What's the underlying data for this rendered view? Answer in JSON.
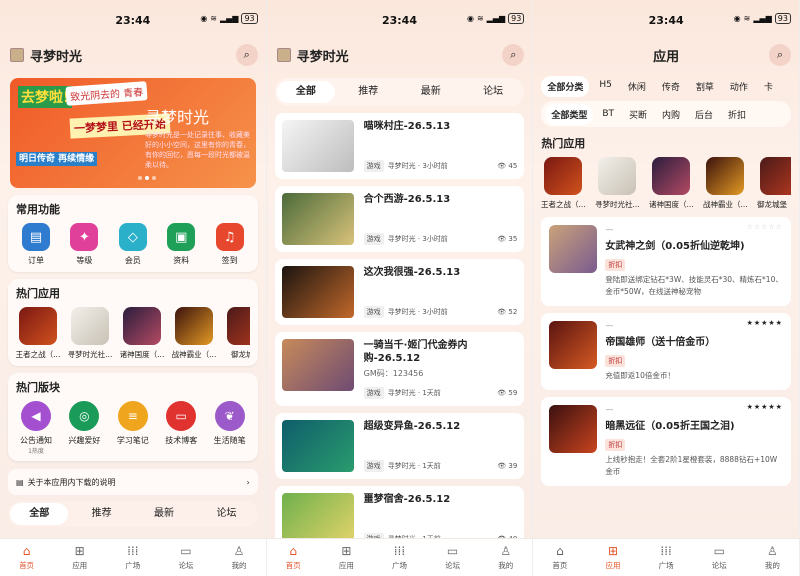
{
  "status": {
    "time": "23:44",
    "battery": "93"
  },
  "panel1": {
    "title": "寻梦时光",
    "banner": {
      "t1": "去梦啦!",
      "t2": "致光阴去的 青春",
      "t3": "一梦梦里 已经开始",
      "t4": "明日传奇 再续情缘",
      "title": "寻梦时光",
      "sub": "寻梦时光是一处记录往事、收藏美好的小小空间，这里有你的青春，有你的回忆，愿每一段时光都被温柔以待。"
    },
    "functions": {
      "title": "常用功能",
      "items": [
        {
          "label": "订单",
          "color": "#2e7bcf",
          "icon": "order-icon"
        },
        {
          "label": "等级",
          "color": "#e0409a",
          "icon": "level-icon"
        },
        {
          "label": "会员",
          "color": "#2bb0c9",
          "icon": "vip-icon"
        },
        {
          "label": "资料",
          "color": "#1fa058",
          "icon": "profile-icon"
        },
        {
          "label": "签到",
          "color": "#e6472d",
          "icon": "bell-icon"
        }
      ]
    },
    "hot_apps": {
      "title": "热门应用",
      "items": [
        {
          "name": "王者之战（..."
        },
        {
          "name": "寻梦时光社..."
        },
        {
          "name": "诸神国度（..."
        },
        {
          "name": "战神霸业（..."
        },
        {
          "name": "御龙城堡"
        }
      ]
    },
    "sections": {
      "title": "热门版块",
      "items": [
        {
          "label": "公告通知",
          "sub": "1热度",
          "color": "#a44fd0"
        },
        {
          "label": "兴趣爱好",
          "sub": "",
          "color": "#1b9b59"
        },
        {
          "label": "学习笔记",
          "sub": "",
          "color": "#f0a51f"
        },
        {
          "label": "技术博客",
          "sub": "",
          "color": "#e0322f"
        },
        {
          "label": "生活随笔",
          "sub": "",
          "color": "#9b59c9"
        }
      ]
    },
    "notice": "关于本应用内下载的说明",
    "tabs": [
      "全部",
      "推荐",
      "最新",
      "论坛"
    ]
  },
  "panel2": {
    "title": "寻梦时光",
    "tabs": [
      "全部",
      "推荐",
      "最新",
      "论坛"
    ],
    "posts": [
      {
        "title": "喵咪村庄-26.5.13",
        "code": "",
        "tag": "游戏",
        "author": "寻梦时光",
        "time": "3小时前",
        "views": "45"
      },
      {
        "title": "合个西游-26.5.13",
        "code": "",
        "tag": "游戏",
        "author": "寻梦时光",
        "time": "3小时前",
        "views": "35"
      },
      {
        "title": "这次我很强-26.5.13",
        "code": "",
        "tag": "游戏",
        "author": "寻梦时光",
        "time": "3小时前",
        "views": "52"
      },
      {
        "title": "一骑当千·姬门代金券内购-26.5.12",
        "code": "GM码：123456",
        "tag": "游戏",
        "author": "寻梦时光",
        "time": "1天前",
        "views": "59"
      },
      {
        "title": "超级变异鱼-26.5.12",
        "code": "",
        "tag": "游戏",
        "author": "寻梦时光",
        "time": "1天前",
        "views": "39"
      },
      {
        "title": "噩梦宿舍-26.5.12",
        "code": "",
        "tag": "游戏",
        "author": "寻梦时光",
        "time": "1天前",
        "views": "40"
      }
    ]
  },
  "panel3": {
    "title": "应用",
    "cats": [
      "全部分类",
      "H5",
      "休闲",
      "传奇",
      "割草",
      "动作",
      "卡"
    ],
    "types": [
      "全部类型",
      "BT",
      "买断",
      "内购",
      "后台",
      "折扣"
    ],
    "hot_title": "热门应用",
    "hot": [
      {
        "name": "王者之战（..."
      },
      {
        "name": "寻梦时光社..."
      },
      {
        "name": "诸神国度（..."
      },
      {
        "name": "战神霸业（..."
      },
      {
        "name": "御龙城堡（..."
      }
    ],
    "games": [
      {
        "dash": "—",
        "name": "女武神之剑（0.05折仙逆乾坤)",
        "tag": "折扣",
        "desc": "登陆即送绑定钻石*3W、技能灵石*30、精炼石*10、金币*50W，在线送神秘宠物",
        "stars": "☆☆☆☆☆"
      },
      {
        "dash": "—",
        "name": "帝国雄师（送十倍金币）",
        "tag": "折扣",
        "desc": "充值即返10倍金币！",
        "stars": "★★★★★"
      },
      {
        "dash": "—",
        "name": "暗黑远征（0.05折王国之泪)",
        "tag": "折扣",
        "desc": "上线秒抱走！全套2阶1星橙套装，8888钻石+10W金币",
        "stars": "★★★★★"
      }
    ]
  },
  "nav": {
    "items": [
      "首页",
      "应用",
      "广场",
      "论坛",
      "我的"
    ]
  }
}
